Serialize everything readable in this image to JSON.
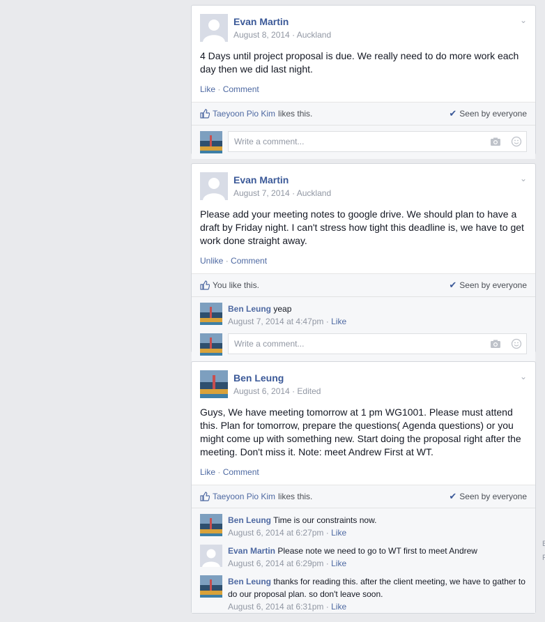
{
  "posts": [
    {
      "author": "Evan Martin",
      "date": "August 8, 2014",
      "sep": "·",
      "place": "Auckland",
      "body": "4 Days until project proposal is due. We really need to do more work each day then we did last night.",
      "like_action": "Like",
      "comment_action": "Comment",
      "liker": "Taeyoon Pio Kim",
      "likes_rest": "likes this.",
      "seen": "Seen by everyone",
      "placeholder": "Write a comment..."
    },
    {
      "author": "Evan Martin",
      "date": "August 7, 2014",
      "sep": "·",
      "place": "Auckland",
      "body": "Please add your meeting notes to google drive. We should plan to have a draft by Friday night. I can't stress how tight this deadline is, we have to get work done straight away.",
      "like_action": "Unlike",
      "comment_action": "Comment",
      "likes_text": "You like this.",
      "seen": "Seen by everyone",
      "comments": [
        {
          "author": "Ben Leung",
          "text": "yeap",
          "time": "August 7, 2014 at 4:47pm",
          "like": "Like"
        }
      ],
      "placeholder": "Write a comment..."
    },
    {
      "author": "Ben Leung",
      "date": "August 6, 2014",
      "sep": "·",
      "place": "Edited",
      "body": "Guys, We have meeting tomorrow at 1 pm WG1001. Please must attend this. Plan for tomorrow, prepare the questions( Agenda questions) or you might come up with something new. Start doing the proposal right after the meeting. Don't miss it. Note: meet Andrew First at WT.",
      "like_action": "Like",
      "comment_action": "Comment",
      "liker": "Taeyoon Pio Kim",
      "likes_rest": "likes this.",
      "seen": "Seen by everyone",
      "comments": [
        {
          "author": "Ben Leung",
          "text": "Time is our constraints now.",
          "time": "August 6, 2014 at 6:27pm",
          "like": "Like"
        },
        {
          "author": "Evan Martin",
          "text": "Please note we need to go to WT first to meet Andrew",
          "time": "August 6, 2014 at 6:29pm",
          "like": "Like"
        },
        {
          "author": "Ben Leung",
          "text": "thanks for reading this. after the client meeting, we have to gather to do our proposal plan. so don't leave soon.",
          "time": "August 6, 2014 at 6:31pm",
          "like": "Like"
        }
      ]
    }
  ],
  "edge_letters": [
    "E",
    "F"
  ],
  "icons": {
    "chevron": "chevron-down-icon",
    "thumb": "thumbs-up-icon",
    "check": "check-icon",
    "camera": "camera-icon",
    "smile": "smile-icon"
  },
  "colors": {
    "link": "#4e69a2",
    "author": "#3b5998",
    "muted": "#9197a3",
    "bg": "#e9eaed"
  }
}
